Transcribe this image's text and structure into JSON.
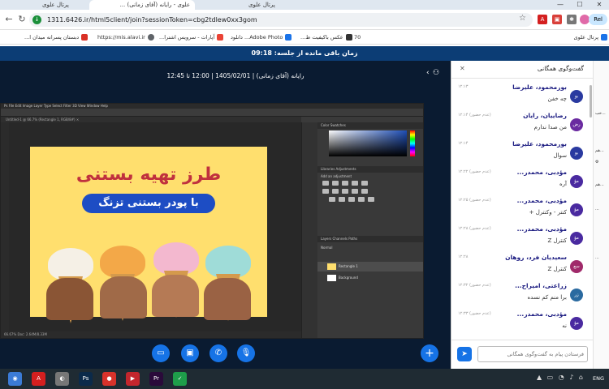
{
  "browser": {
    "tabs": [
      {
        "label": "پرتال علوی",
        "active": false
      },
      {
        "label": "علوی - رایانه (آفای زمانی) ...",
        "active": true
      }
    ],
    "window_controls": {
      "minimize": "—",
      "maximize": "☐",
      "close": "✕"
    },
    "url": "1311.6426.ir/html5client/join?sessionToken=cbg2tdlew0xx3gom",
    "profile_label": "Rel",
    "bookmarks": [
      {
        "label": "پرتال علوی",
        "color": "#1a73e8"
      },
      {
        "label": "دبستان پسرانه میدان ا...",
        "color": "#d93025"
      },
      {
        "label": "https://mis.alavi.ir",
        "color": "#5f6368"
      },
      {
        "label": "آپارات - سرویس اشترا...",
        "color": "#ea4335"
      },
      {
        "label": "Adobe Photo... دانلود",
        "color": "#1a73e8"
      },
      {
        "label": "عکس باکیفیت ط...",
        "color": "#333333"
      },
      {
        "label": "70",
        "color": "#777777"
      }
    ]
  },
  "session": {
    "timer_text": "زمان باقی مانده از جلسه: 09:18",
    "room_title": "رایانه (آقای زمانی) | 1405/02/01 | 12:00 تا 12:45"
  },
  "photoshop": {
    "menu": "Ps   File   Edit   Image   Layer   Type   Select   Filter   3D   View   Window   Help",
    "doc_tab": "Untitled-1 @ 66.7% (Rectangle 1, RGB/8#) ×",
    "status": "66.67%      Doc: 2.64M/8.33M",
    "panel_tabs_top": "Color    Swatches",
    "panel_tabs_adj": "Libraries    Adjustments",
    "adj_label": "Add an adjustment",
    "panel_tabs_layers": "Layers    Channels    Paths",
    "layer_mode": "Normal",
    "layers": [
      {
        "name": "Rectangle 1",
        "thumb": "#ffdf6e"
      },
      {
        "name": "Background",
        "thumb": "#ffffff"
      }
    ]
  },
  "artwork": {
    "title": "طرز تهیه بستنی",
    "subtitle": "با پودر بستنی تزنگ",
    "scoop_colors": [
      "#f5f0e6",
      "#f3a848",
      "#f3b8cf",
      "#9fdcd8"
    ]
  },
  "controls": {
    "share_screen_icon": "▭",
    "camera_icon": "▣",
    "phone_icon": "✆",
    "mic_off_icon": "🎙",
    "plus": "+"
  },
  "chat": {
    "title": "گفت‌وگوی همگانی",
    "close_icon": "✕",
    "input_placeholder": "فرستادن پیام به گفت‌وگوی همگانی",
    "send_icon": "➤",
    "messages": [
      {
        "name": "بورمحمود، علیرضا",
        "time": "۱۲:۱۳",
        "text": "چه خفن",
        "avatar": "بو",
        "color": "#2a3aa0"
      },
      {
        "name": "رضاییان، رایان",
        "time": "(عدم حضور) ۱۲:۱۴",
        "text": "من صدا ندارم",
        "avatar": "رض",
        "color": "#6a2aa0"
      },
      {
        "name": "بورمحمود، علیرضا",
        "time": "۱۲:۱۴",
        "text": "سوال",
        "avatar": "بو",
        "color": "#2a3aa0"
      },
      {
        "name": "مؤدبی، محمدر...",
        "time": "(عدم حضور) ۱۲:۲۲",
        "text": "آره",
        "avatar": "مؤ",
        "color": "#4a2aa0"
      },
      {
        "name": "مؤدبی، محمدر...",
        "time": "(عدم حضور) ۱۲:۲۵",
        "text": "کنتر - وکنترل +",
        "avatar": "مؤ",
        "color": "#4a2aa0"
      },
      {
        "name": "مؤدبی، محمدر...",
        "time": "(عدم حضور) ۱۲:۲۸",
        "text": "کنترل Z",
        "avatar": "مؤ",
        "color": "#4a2aa0"
      },
      {
        "name": "سعیدیان فرد، روهان",
        "time": "۱۲:۲۸",
        "text": "کنترل Z",
        "avatar": "سع",
        "color": "#a02a6a"
      },
      {
        "name": "زراعتی، امیراح...",
        "time": "(عدم حضور) ۱۲:۳۲",
        "text": "برا منم کم نسده",
        "avatar": "زر",
        "color": "#2a6aa0"
      },
      {
        "name": "مؤدبی، محمدر...",
        "time": "(عدم حضور) ۱۲:۳۳",
        "text": "نه",
        "avatar": "مؤ",
        "color": "#4a2aa0"
      }
    ]
  },
  "side_strip": [
    "...خب",
    "...هم",
    "...هم",
    "...",
    "..."
  ],
  "taskbar": {
    "apps": [
      {
        "name": "chrome",
        "label": "◉",
        "color": "#3b7bd6"
      },
      {
        "name": "acrobat",
        "label": "A",
        "color": "#d41f1f"
      },
      {
        "name": "media",
        "label": "◐",
        "color": "#777777"
      },
      {
        "name": "photoshop",
        "label": "Ps",
        "color": "#0b2a4a"
      },
      {
        "name": "recorder",
        "label": "●",
        "color": "#d8322b"
      },
      {
        "name": "screen",
        "label": "▶",
        "color": "#c3262d"
      },
      {
        "name": "premiere",
        "label": "Pr",
        "color": "#2a0a3a"
      },
      {
        "name": "shield",
        "label": "✓",
        "color": "#1e9e4a"
      }
    ],
    "tray": "▲ ▭ ◔ ♪ ⌂",
    "lang": "ENG"
  }
}
